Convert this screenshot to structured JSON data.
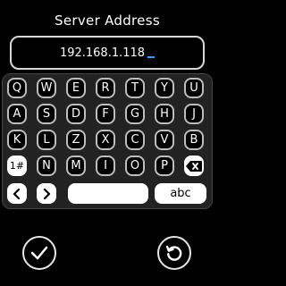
{
  "header": {
    "title": "Server Address"
  },
  "input": {
    "value": "192.168.1.118"
  },
  "keyboard": {
    "row1": [
      "Q",
      "W",
      "E",
      "R",
      "T",
      "Y",
      "U"
    ],
    "row2": [
      "A",
      "S",
      "D",
      "F",
      "G",
      "H",
      "J"
    ],
    "row3": [
      "K",
      "L",
      "Z",
      "X",
      "C",
      "V",
      "B"
    ],
    "row4": [
      "1#",
      "N",
      "M",
      "I",
      "O",
      "P"
    ],
    "abc_label": "abc"
  },
  "icons": {
    "backspace": "backspace-icon",
    "left": "chevron-left-icon",
    "right": "chevron-right-icon",
    "confirm": "check-icon",
    "reset": "reset-icon"
  }
}
